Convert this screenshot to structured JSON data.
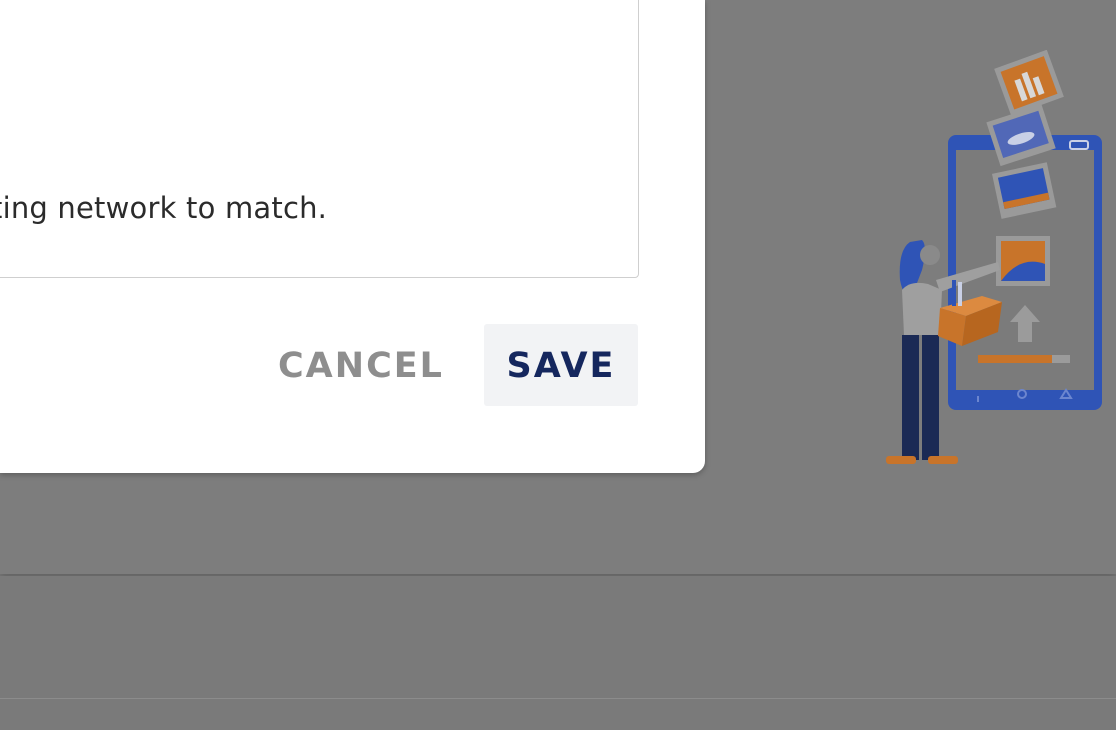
{
  "dialog": {
    "description_text": "ting network to match.",
    "cancel_label": "CANCEL",
    "save_label": "SAVE"
  },
  "colors": {
    "overlay": "#7b7b7b",
    "dialog_bg": "#ffffff",
    "save_text": "#15275e",
    "cancel_text": "#8e8e8e",
    "illustration_blue": "#2f54b6",
    "illustration_orange": "#c8742a",
    "illustration_navy": "#1b2a55"
  },
  "illustration": {
    "name": "person-uploading-photos-to-phone"
  }
}
